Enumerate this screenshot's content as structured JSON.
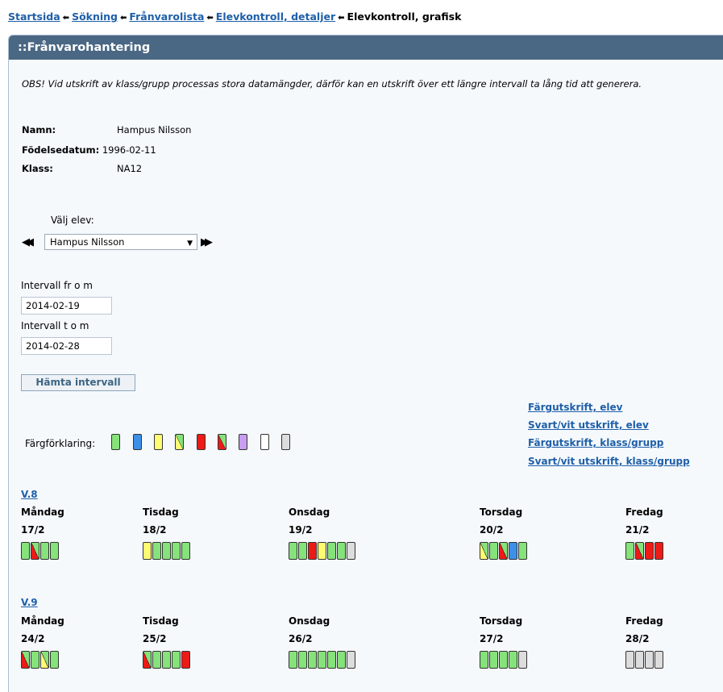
{
  "breadcrumb": {
    "items": [
      "Startsida",
      "Sökning",
      "Frånvarolista",
      "Elevkontroll, detaljer"
    ],
    "current": "Elevkontroll, grafisk"
  },
  "panel": {
    "title": "::Frånvarohantering",
    "notice": "OBS! Vid utskrift av klass/grupp processas stora datamängder, därför kan en utskrift över ett längre intervall ta lång tid att generera."
  },
  "student": {
    "name_label": "Namn:",
    "name": "Hampus Nilsson",
    "birth_label": "Födelsedatum:",
    "birth": "1996-02-11",
    "class_label": "Klass:",
    "class": "NA12"
  },
  "selector": {
    "label": "Välj elev:",
    "selected": "Hampus Nilsson",
    "prev_icon": "rewind-icon",
    "next_icon": "fast-forward-icon"
  },
  "interval": {
    "from_label": "Intervall fr o m",
    "from_value": "2014-02-19",
    "to_label": "Intervall t o m",
    "to_value": "2014-02-28",
    "button": "Hämta intervall"
  },
  "print_links": [
    "Färgutskrift, elev",
    "Svart/vit utskrift, elev",
    "Färgutskrift, klass/grupp",
    "Svart/vit utskrift, klass/grupp"
  ],
  "legend": {
    "label": "Färgförklaring:",
    "swatches": [
      "green",
      "blue",
      "yellow",
      "yellow-green",
      "red",
      "red-green",
      "lilac",
      "white",
      "grey"
    ]
  },
  "colors": {
    "green": "#86e27a",
    "blue": "#3d8fe8",
    "yellow": "#fffb73",
    "red": "#ee1a16",
    "lilac": "#c79ef0",
    "grey": "#dddddd",
    "header": "#4a6784",
    "link": "#1f5fa8"
  },
  "weeks": [
    {
      "label": "V.8",
      "days": [
        {
          "name": "Måndag",
          "date": "17/2",
          "cells": [
            "green",
            "red-green",
            "green",
            "green"
          ]
        },
        {
          "name": "Tisdag",
          "date": "18/2",
          "cells": [
            "yellow",
            "green",
            "green",
            "green",
            "green"
          ]
        },
        {
          "name": "Onsdag",
          "date": "19/2",
          "cells": [
            "green",
            "green",
            "red",
            "yellow",
            "green",
            "green",
            "grey"
          ]
        },
        {
          "name": "Torsdag",
          "date": "20/2",
          "cells": [
            "yellow-green",
            "green",
            "red-green",
            "blue",
            "green"
          ]
        },
        {
          "name": "Fredag",
          "date": "21/2",
          "cells": [
            "green",
            "red-green",
            "red",
            "red"
          ]
        }
      ]
    },
    {
      "label": "V.9",
      "days": [
        {
          "name": "Måndag",
          "date": "24/2",
          "cells": [
            "red-green",
            "green",
            "yellow-green",
            "green"
          ]
        },
        {
          "name": "Tisdag",
          "date": "25/2",
          "cells": [
            "red-green",
            "green",
            "green",
            "green",
            "red"
          ]
        },
        {
          "name": "Onsdag",
          "date": "26/2",
          "cells": [
            "green",
            "green",
            "green",
            "green",
            "green",
            "green",
            "grey"
          ]
        },
        {
          "name": "Torsdag",
          "date": "27/2",
          "cells": [
            "green",
            "green",
            "green",
            "green",
            "grey"
          ]
        },
        {
          "name": "Fredag",
          "date": "28/2",
          "cells": [
            "grey",
            "grey",
            "grey",
            "grey"
          ]
        }
      ]
    }
  ]
}
